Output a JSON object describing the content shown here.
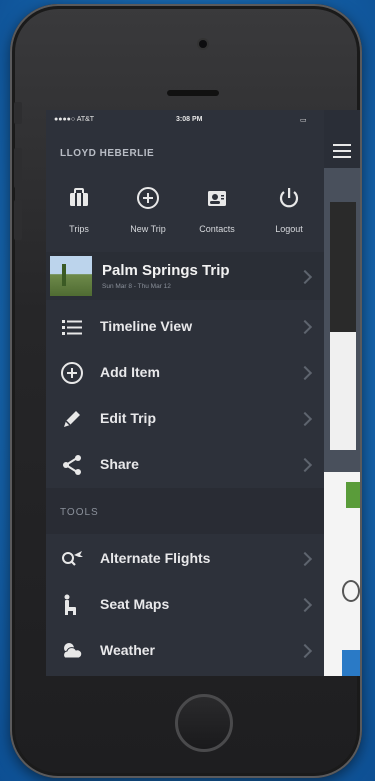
{
  "status_bar": {
    "carrier": "●●●●○ AT&T",
    "time": "3:08 PM",
    "battery": "▭"
  },
  "user": {
    "name": "LLOYD HEBERLIE"
  },
  "top_actions": [
    {
      "label": "Trips",
      "icon": "briefcase-icon"
    },
    {
      "label": "New Trip",
      "icon": "plus-circle-icon"
    },
    {
      "label": "Contacts",
      "icon": "contacts-icon"
    },
    {
      "label": "Logout",
      "icon": "power-icon"
    }
  ],
  "trip": {
    "title": "Palm Springs Trip",
    "dates": "Sun Mar 8 - Thu Mar 12"
  },
  "menu_items": [
    {
      "label": "Timeline View",
      "icon": "list-icon"
    },
    {
      "label": "Add Item",
      "icon": "plus-circle-icon"
    },
    {
      "label": "Edit Trip",
      "icon": "pencil-icon"
    },
    {
      "label": "Share",
      "icon": "share-icon"
    }
  ],
  "tools": {
    "header": "TOOLS",
    "items": [
      {
        "label": "Alternate Flights",
        "icon": "flight-search-icon"
      },
      {
        "label": "Seat Maps",
        "icon": "seat-icon"
      },
      {
        "label": "Weather",
        "icon": "weather-icon"
      }
    ]
  }
}
